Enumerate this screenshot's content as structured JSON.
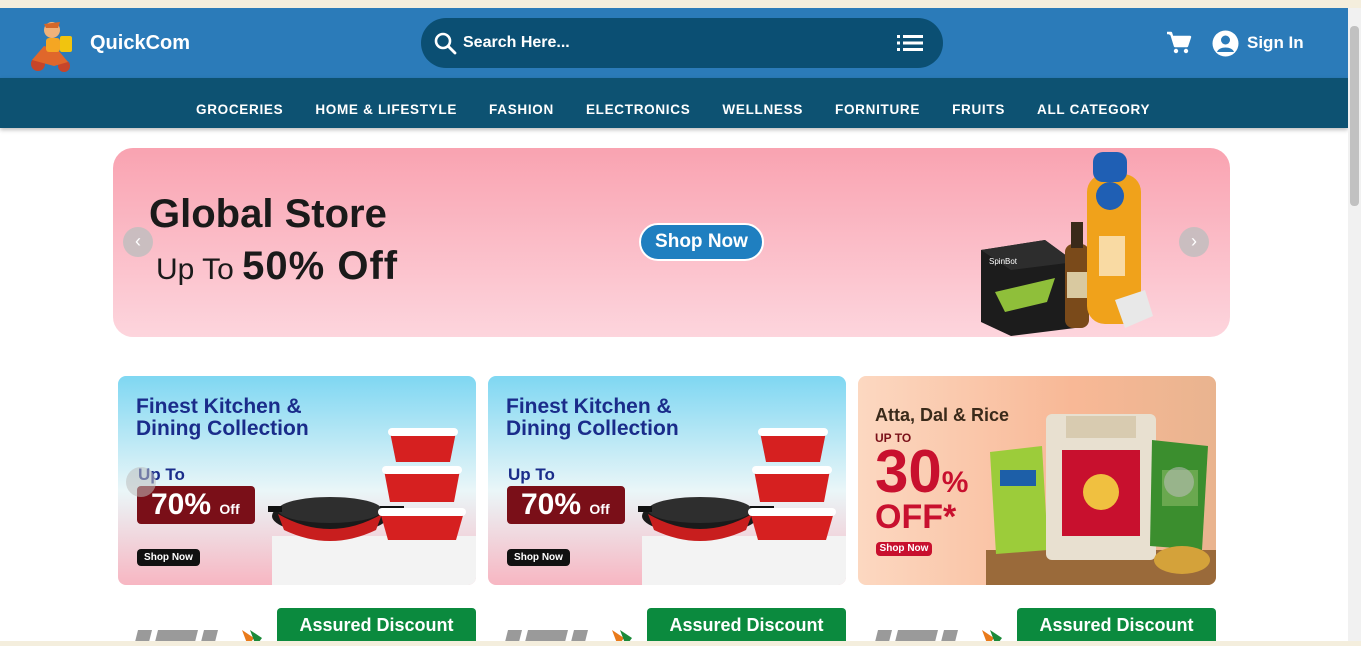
{
  "header": {
    "brand": "QuickCom",
    "search_placeholder": "Search Here...",
    "sign_in": "Sign In"
  },
  "nav": {
    "items": [
      "GROCERIES",
      "HOME & LIFESTYLE",
      "FASHION",
      "ELECTRONICS",
      "WELLNESS",
      "FORNITURE",
      "FRUITS",
      "ALL CATEGORY"
    ]
  },
  "hero": {
    "title": "Global Store",
    "subtitle_prefix": "Up To",
    "subtitle_value": "50% Off",
    "button": "Shop Now",
    "prev": "‹",
    "next": "›"
  },
  "offers": [
    {
      "title_line1": "Finest Kitchen &",
      "title_line2": "Dining Collection",
      "upto": "Up To",
      "discount": "70%",
      "discount_suffix": "Off",
      "shop": "Shop Now"
    },
    {
      "title_line1": "Finest Kitchen &",
      "title_line2": "Dining Collection",
      "upto": "Up To",
      "discount": "70%",
      "discount_suffix": "Off",
      "shop": "Shop Now"
    },
    {
      "title": "Atta, Dal & Rice",
      "upto": "UP TO",
      "discount": "30",
      "percent": "%",
      "off": "OFF*",
      "shop": "Shop Now"
    }
  ],
  "bottom_cards": [
    {
      "label": "Assured Discount"
    },
    {
      "label": "Assured Discount"
    },
    {
      "label": "Assured Discount"
    }
  ],
  "colors": {
    "header": "#2b7bb9",
    "nav": "#0d5272",
    "search": "#0b4f73",
    "accent_green": "#0b8a3e"
  }
}
